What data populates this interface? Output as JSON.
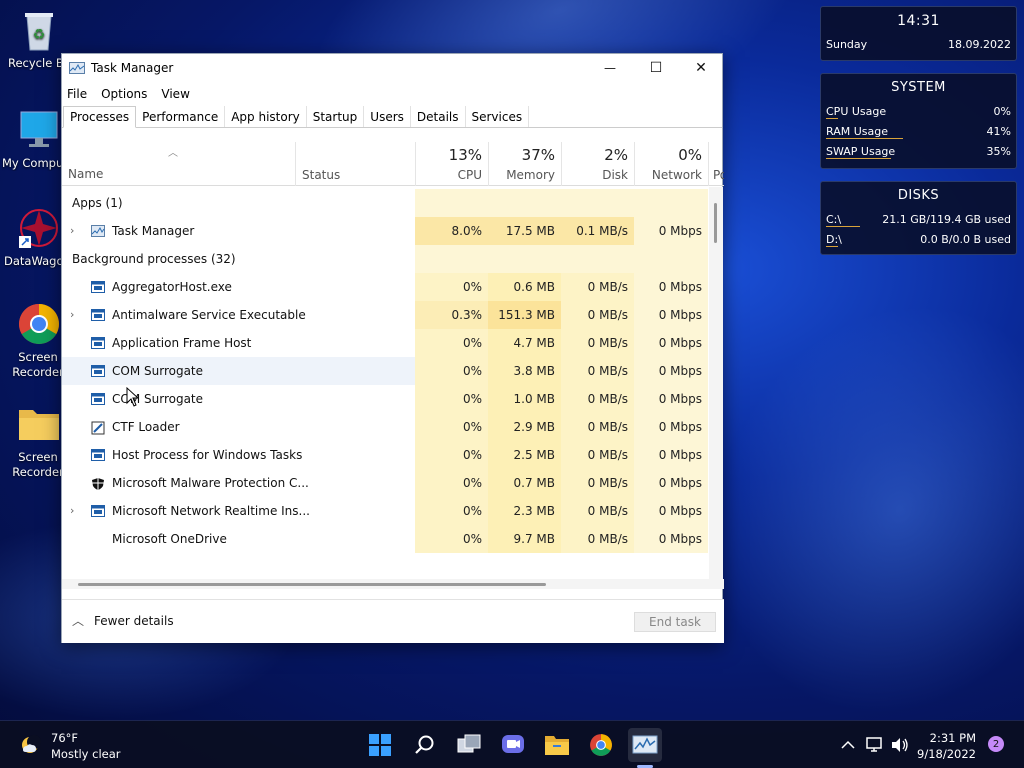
{
  "desktop": {
    "icons": [
      {
        "label": "Recycle Bin",
        "id": "recycle-bin"
      },
      {
        "label": "My Computer",
        "id": "my-computer"
      },
      {
        "label": "DataWagon",
        "id": "datawagon"
      },
      {
        "label": "Screen Recorder",
        "id": "screen-recorder-chrome"
      },
      {
        "label": "Screen Recorder",
        "id": "screen-recorder-folder"
      }
    ]
  },
  "widgets": {
    "clock": {
      "time": "14:31",
      "day": "Sunday",
      "date": "18.09.2022"
    },
    "system": {
      "title": "SYSTEM",
      "rows": [
        {
          "label": "CPU Usage",
          "value": "0%",
          "fraction": 0.0
        },
        {
          "label": "RAM Usage",
          "value": "41%",
          "fraction": 0.41
        },
        {
          "label": "SWAP Usage",
          "value": "35%",
          "fraction": 0.35
        }
      ]
    },
    "disks": {
      "title": "DISKS",
      "rows": [
        {
          "label": "C:\\",
          "value": "21.1 GB/119.4 GB used",
          "fraction": 0.18
        },
        {
          "label": "D:\\",
          "value": "0.0 B/0.0 B used",
          "fraction": 0.0
        }
      ]
    }
  },
  "window": {
    "title": "Task Manager",
    "controls": {
      "minimize": "—",
      "maximize": "☐",
      "close": "✕"
    },
    "menu": [
      "File",
      "Options",
      "View"
    ],
    "tabs": [
      "Processes",
      "Performance",
      "App history",
      "Startup",
      "Users",
      "Details",
      "Services"
    ],
    "active_tab": "Processes",
    "columns": {
      "name": "Name",
      "status": "Status",
      "cpu": {
        "pct": "13%",
        "label": "CPU"
      },
      "memory": {
        "pct": "37%",
        "label": "Memory"
      },
      "disk": {
        "pct": "2%",
        "label": "Disk"
      },
      "network": {
        "pct": "0%",
        "label": "Network"
      },
      "power": {
        "label": "Po"
      }
    },
    "rows": [
      {
        "type": "group",
        "label": "Apps (1)"
      },
      {
        "type": "proc",
        "name": "Task Manager",
        "expand": true,
        "icon": "taskmgr",
        "cpu": "8.0%",
        "mem": "17.5 MB",
        "disk": "0.1 MB/s",
        "net": "0 Mbps"
      },
      {
        "type": "group",
        "label": "Background processes (32)"
      },
      {
        "type": "proc",
        "name": "AggregatorHost.exe",
        "expand": false,
        "icon": "app",
        "cpu": "0%",
        "mem": "0.6 MB",
        "disk": "0 MB/s",
        "net": "0 Mbps"
      },
      {
        "type": "proc",
        "name": "Antimalware Service Executable",
        "expand": true,
        "icon": "app",
        "cpu": "0.3%",
        "mem": "151.3 MB",
        "disk": "0 MB/s",
        "net": "0 Mbps"
      },
      {
        "type": "proc",
        "name": "Application Frame Host",
        "expand": false,
        "icon": "app",
        "cpu": "0%",
        "mem": "4.7 MB",
        "disk": "0 MB/s",
        "net": "0 Mbps"
      },
      {
        "type": "proc",
        "name": "COM Surrogate",
        "expand": false,
        "icon": "app",
        "cpu": "0%",
        "mem": "3.8 MB",
        "disk": "0 MB/s",
        "net": "0 Mbps",
        "hover": true
      },
      {
        "type": "proc",
        "name": "COM Surrogate",
        "expand": false,
        "icon": "app",
        "cpu": "0%",
        "mem": "1.0 MB",
        "disk": "0 MB/s",
        "net": "0 Mbps"
      },
      {
        "type": "proc",
        "name": "CTF Loader",
        "expand": false,
        "icon": "ctf",
        "cpu": "0%",
        "mem": "2.9 MB",
        "disk": "0 MB/s",
        "net": "0 Mbps"
      },
      {
        "type": "proc",
        "name": "Host Process for Windows Tasks",
        "expand": false,
        "icon": "app",
        "cpu": "0%",
        "mem": "2.5 MB",
        "disk": "0 MB/s",
        "net": "0 Mbps"
      },
      {
        "type": "proc",
        "name": "Microsoft Malware Protection C...",
        "expand": false,
        "icon": "shield",
        "cpu": "0%",
        "mem": "0.7 MB",
        "disk": "0 MB/s",
        "net": "0 Mbps"
      },
      {
        "type": "proc",
        "name": "Microsoft Network Realtime Ins...",
        "expand": true,
        "icon": "app",
        "cpu": "0%",
        "mem": "2.3 MB",
        "disk": "0 MB/s",
        "net": "0 Mbps"
      },
      {
        "type": "proc",
        "name": "Microsoft OneDrive",
        "expand": false,
        "icon": "none",
        "cpu": "0%",
        "mem": "9.7 MB",
        "disk": "0 MB/s",
        "net": "0 Mbps"
      }
    ],
    "footer": {
      "fewer_details": "Fewer details",
      "end_task": "End task"
    }
  },
  "taskbar": {
    "weather": {
      "temp": "76°F",
      "desc": "Mostly clear"
    },
    "clock": {
      "time": "2:31 PM",
      "date": "9/18/2022"
    },
    "notifications": "2"
  }
}
